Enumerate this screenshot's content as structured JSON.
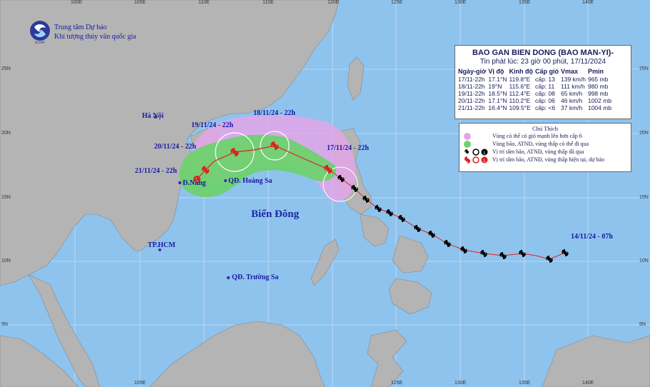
{
  "logo": {
    "text": "NCHMF",
    "line1": "Trung tâm Dự báo",
    "line2": "Khí tượng thủy văn quốc gia"
  },
  "info": {
    "title": "BAO GAN BIEN DONG (BAO MAN-YI)-",
    "issued": "Tin phát lúc: 23 giờ 00 phút, 17/11/2024",
    "headers": [
      "Ngày-giờ",
      "Vị độ",
      "Kinh độ",
      "Cấp gió",
      "Vmax",
      "Pmin"
    ],
    "rows": [
      [
        "17/11-22h",
        "17.1°N",
        "119.8°E",
        "cấp: 13",
        "139 km/h",
        "965 mb"
      ],
      [
        "18/11-22h",
        "19°N",
        "115.6°E",
        "cấp: 11",
        "111 km/h",
        "980 mb"
      ],
      [
        "19/11-22h",
        "18.5°N",
        "112.4°E",
        "cấp: 08",
        "65 km/h",
        "998 mb"
      ],
      [
        "20/11-22h",
        "17.1°N",
        "110.2°E",
        "cấp: 06",
        "46 km/h",
        "1002 mb"
      ],
      [
        "21/11-22h",
        "16.4°N",
        "109.5°E",
        "cấp: <6",
        "37 km/h",
        "1004 mb"
      ]
    ]
  },
  "legend": {
    "title": "Chú Thích",
    "items": [
      "Vùng có thể có gió mạnh lên hơn cấp 6",
      "Vùng bão, ATNĐ, vùng thấp có thể đi qua",
      "Vị trí tâm bão, ATNĐ, vùng thấp đã qua",
      "Vị trí tâm bão, ATNĐ, vùng thấp hiện tại, dự báo"
    ]
  },
  "places": {
    "hanoi": "Hà Nội",
    "danang": "Đ.Nẵng",
    "hoangsa": "QĐ. Hoàng Sa",
    "truongsa": "QĐ. Trường Sa",
    "hcm": "TP.HCM",
    "sea": "Biển Đông"
  },
  "track_labels": {
    "t1": "17/11/24 - 22h",
    "t2": "18/11/24 - 22h",
    "t3": "19/11/24 - 22h",
    "t4": "20/11/24 - 22h",
    "t5": "21/11/24 - 22h",
    "start": "14/11/24 - 07h"
  },
  "grid": {
    "lon_top": [
      "100E",
      "105E",
      "110E",
      "115E",
      "120E",
      "125E",
      "130E",
      "135E",
      "140E"
    ],
    "lon_bottom": [
      "105E",
      "125E",
      "130E",
      "135E",
      "140E"
    ],
    "lat_left": [
      "25N",
      "20N",
      "15N",
      "10N",
      "5N"
    ],
    "lat_right": [
      "25N",
      "20N",
      "15N",
      "10N",
      "5N"
    ]
  },
  "colors": {
    "sea": "#8ec3ee",
    "land": "#b4b4b4",
    "danger": "#e3a6e6",
    "storm": "#6fd16f",
    "track": "#e02020"
  }
}
